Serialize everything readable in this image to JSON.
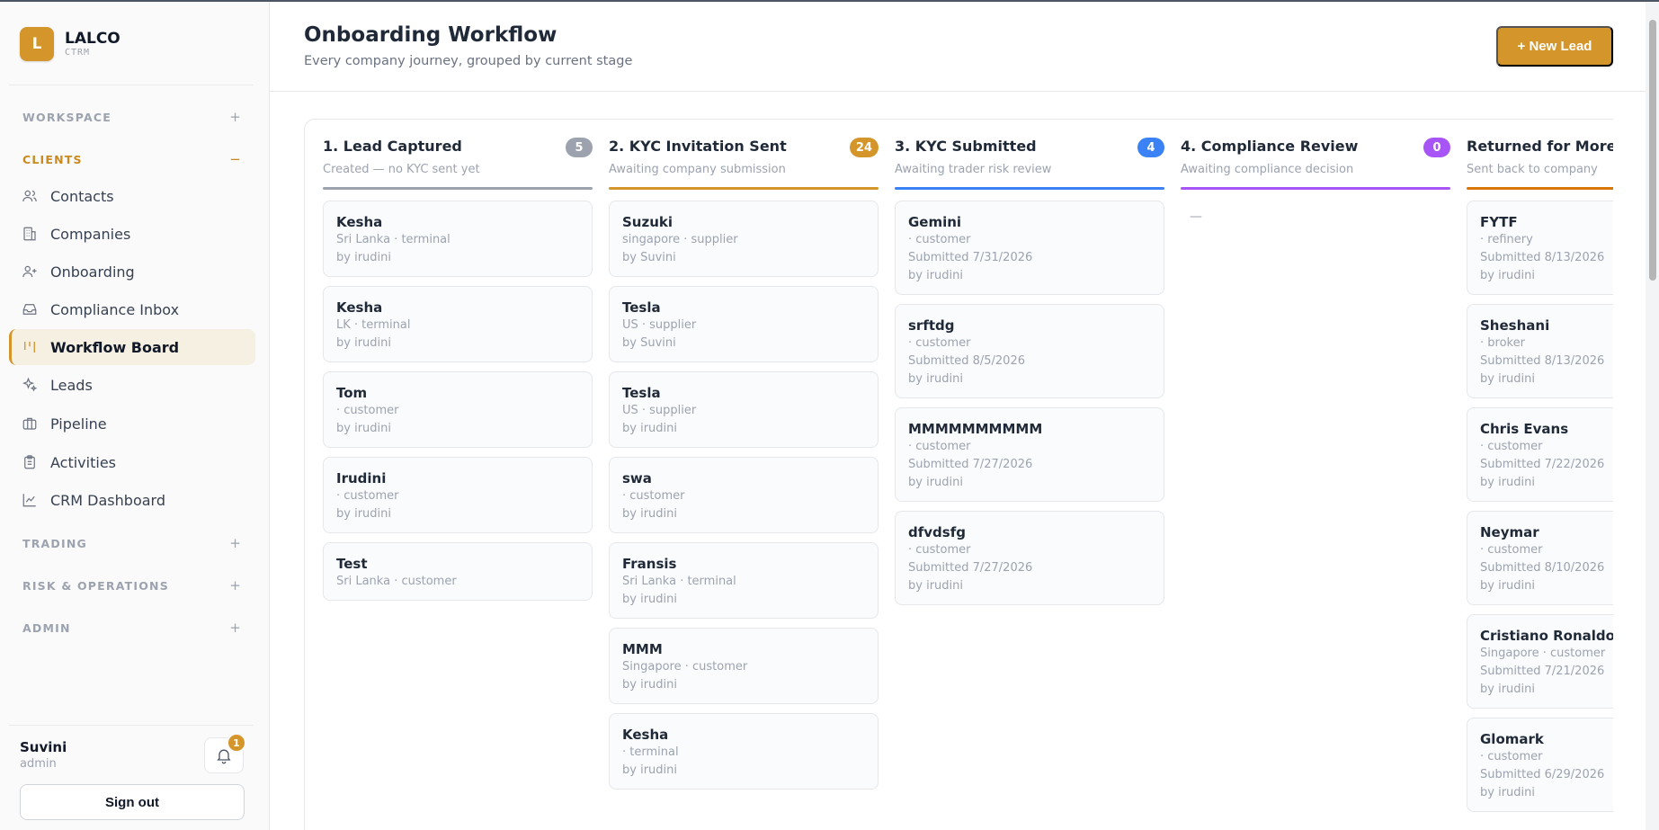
{
  "brand": {
    "logo_letter": "L",
    "name": "LALCO",
    "sub": "CTRM"
  },
  "sidebar": {
    "sections": {
      "workspace": {
        "label": "WORKSPACE",
        "toggle": "+"
      },
      "clients": {
        "label": "CLIENTS",
        "toggle": "−"
      },
      "trading": {
        "label": "TRADING",
        "toggle": "+"
      },
      "risk": {
        "label": "RISK & OPERATIONS",
        "toggle": "+"
      },
      "admin": {
        "label": "ADMIN",
        "toggle": "+"
      }
    },
    "items": [
      {
        "label": "Contacts",
        "icon": "users-icon"
      },
      {
        "label": "Companies",
        "icon": "building-icon"
      },
      {
        "label": "Onboarding",
        "icon": "user-plus-icon"
      },
      {
        "label": "Compliance Inbox",
        "icon": "inbox-icon"
      },
      {
        "label": "Workflow Board",
        "icon": "kanban-icon",
        "selected": true
      },
      {
        "label": "Leads",
        "icon": "sparkles-icon"
      },
      {
        "label": "Pipeline",
        "icon": "briefcase-icon"
      },
      {
        "label": "Activities",
        "icon": "clipboard-icon"
      },
      {
        "label": "CRM Dashboard",
        "icon": "chart-line-icon"
      }
    ]
  },
  "user": {
    "name": "Suvini",
    "role": "admin",
    "notifications": "1",
    "sign_out": "Sign out"
  },
  "header": {
    "title": "Onboarding Workflow",
    "subtitle": "Every company journey, grouped by current stage",
    "new_lead": "+ New Lead"
  },
  "columns": [
    {
      "title": "1. Lead Captured",
      "count": "5",
      "desc": "Created — no KYC sent yet",
      "color": "#9ca3af",
      "cards": [
        {
          "name": "Kesha",
          "lines": [
            "Sri Lanka · terminal",
            "by irudini"
          ]
        },
        {
          "name": "Kesha",
          "lines": [
            "LK · terminal",
            "by irudini"
          ]
        },
        {
          "name": "Tom",
          "lines": [
            "· customer",
            "by irudini"
          ]
        },
        {
          "name": "Irudini",
          "lines": [
            "· customer",
            "by irudini"
          ]
        },
        {
          "name": "Test",
          "lines": [
            "Sri Lanka · customer"
          ]
        }
      ]
    },
    {
      "title": "2. KYC Invitation Sent",
      "count": "24",
      "desc": "Awaiting company submission",
      "color": "#d4962a",
      "cards": [
        {
          "name": "Suzuki",
          "lines": [
            "singapore · supplier",
            "by Suvini"
          ]
        },
        {
          "name": "Tesla",
          "lines": [
            "US · supplier",
            "by Suvini"
          ]
        },
        {
          "name": "Tesla",
          "lines": [
            "US · supplier",
            "by irudini"
          ]
        },
        {
          "name": "swa",
          "lines": [
            "· customer",
            "by irudini"
          ]
        },
        {
          "name": "Fransis",
          "lines": [
            "Sri Lanka · terminal",
            "by irudini"
          ]
        },
        {
          "name": "MMM",
          "lines": [
            "Singapore · customer",
            "by irudini"
          ]
        },
        {
          "name": "Kesha",
          "lines": [
            "· terminal",
            "by irudini"
          ]
        }
      ]
    },
    {
      "title": "3. KYC Submitted",
      "count": "4",
      "desc": "Awaiting trader risk review",
      "color": "#3b82f6",
      "cards": [
        {
          "name": "Gemini",
          "lines": [
            "· customer",
            "Submitted 7/31/2026",
            "by irudini"
          ]
        },
        {
          "name": "srftdg",
          "lines": [
            "· customer",
            "Submitted 8/5/2026",
            "by irudini"
          ]
        },
        {
          "name": "MMMMMMMMMM",
          "lines": [
            "· customer",
            "Submitted 7/27/2026",
            "by irudini"
          ]
        },
        {
          "name": "dfvdsfg",
          "lines": [
            "· customer",
            "Submitted 7/27/2026",
            "by irudini"
          ]
        }
      ]
    },
    {
      "title": "4. Compliance Review",
      "count": "0",
      "desc": "Awaiting compliance decision",
      "color": "#a855f7",
      "empty": "—",
      "cards": []
    },
    {
      "title": "Returned for More Info",
      "count": "",
      "desc": "Sent back to company",
      "color": "#d97706",
      "cards": [
        {
          "name": "FYTF",
          "lines": [
            "· refinery",
            "Submitted 8/13/2026",
            "by irudini"
          ]
        },
        {
          "name": "Sheshani",
          "lines": [
            "· broker",
            "Submitted 8/13/2026",
            "by irudini"
          ]
        },
        {
          "name": "Chris Evans",
          "lines": [
            "· customer",
            "Submitted 7/22/2026",
            "by irudini"
          ]
        },
        {
          "name": "Neymar",
          "lines": [
            "· customer",
            "Submitted 8/10/2026",
            "by irudini"
          ]
        },
        {
          "name": "Cristiano Ronaldo",
          "lines": [
            "Singapore · customer",
            "Submitted 7/21/2026",
            "by irudini"
          ]
        },
        {
          "name": "Glomark",
          "lines": [
            "· customer",
            "Submitted 6/29/2026",
            "by irudini"
          ]
        }
      ]
    }
  ]
}
